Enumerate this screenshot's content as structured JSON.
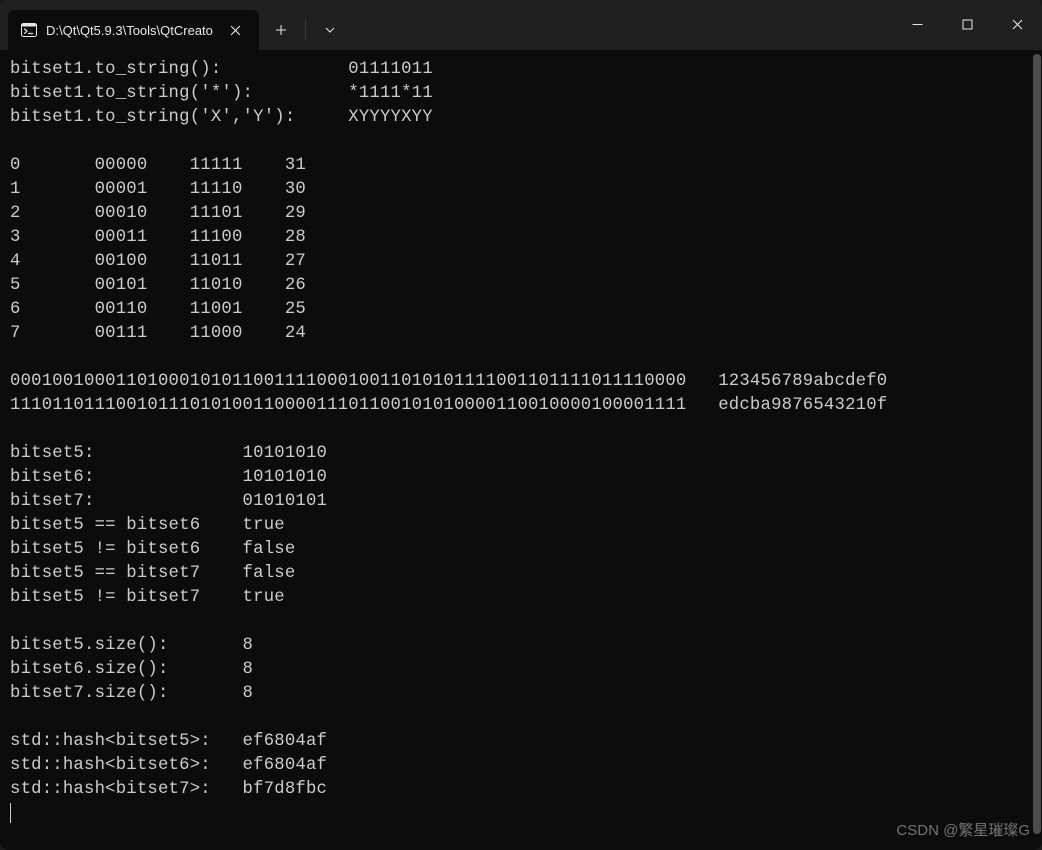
{
  "window": {
    "tab_title": "D:\\Qt\\Qt5.9.3\\Tools\\QtCreato"
  },
  "to_string": [
    {
      "label": "bitset1.to_string():",
      "value": "01111011"
    },
    {
      "label": "bitset1.to_string('*'):",
      "value": "*1111*11"
    },
    {
      "label": "bitset1.to_string('X','Y'):",
      "value": "XYYYYXYY"
    }
  ],
  "table": [
    {
      "n": "0",
      "bin": "00000",
      "inv": "11111",
      "dec": "31"
    },
    {
      "n": "1",
      "bin": "00001",
      "inv": "11110",
      "dec": "30"
    },
    {
      "n": "2",
      "bin": "00010",
      "inv": "11101",
      "dec": "29"
    },
    {
      "n": "3",
      "bin": "00011",
      "inv": "11100",
      "dec": "28"
    },
    {
      "n": "4",
      "bin": "00100",
      "inv": "11011",
      "dec": "27"
    },
    {
      "n": "5",
      "bin": "00101",
      "inv": "11010",
      "dec": "26"
    },
    {
      "n": "6",
      "bin": "00110",
      "inv": "11001",
      "dec": "25"
    },
    {
      "n": "7",
      "bin": "00111",
      "inv": "11000",
      "dec": "24"
    }
  ],
  "long_bits": [
    {
      "bits": "0001001000110100010101100111100010011010101111001101111011110000",
      "hex": "123456789abcdef0"
    },
    {
      "bits": "1110110111001011101010011000011101100101010000110010000100001111",
      "hex": "edcba9876543210f"
    }
  ],
  "bitsets": [
    {
      "label": "bitset5:",
      "value": "10101010"
    },
    {
      "label": "bitset6:",
      "value": "10101010"
    },
    {
      "label": "bitset7:",
      "value": "01010101"
    }
  ],
  "compares": [
    {
      "label": "bitset5 == bitset6",
      "value": "true"
    },
    {
      "label": "bitset5 != bitset6",
      "value": "false"
    },
    {
      "label": "bitset5 == bitset7",
      "value": "false"
    },
    {
      "label": "bitset5 != bitset7",
      "value": "true"
    }
  ],
  "sizes": [
    {
      "label": "bitset5.size():",
      "value": "8"
    },
    {
      "label": "bitset6.size():",
      "value": "8"
    },
    {
      "label": "bitset7.size():",
      "value": "8"
    }
  ],
  "hashes": [
    {
      "label": "std::hash<bitset5>:",
      "value": "ef6804af"
    },
    {
      "label": "std::hash<bitset6>:",
      "value": "ef6804af"
    },
    {
      "label": "std::hash<bitset7>:",
      "value": "bf7d8fbc"
    }
  ],
  "watermark": "CSDN @繁星璀璨G"
}
